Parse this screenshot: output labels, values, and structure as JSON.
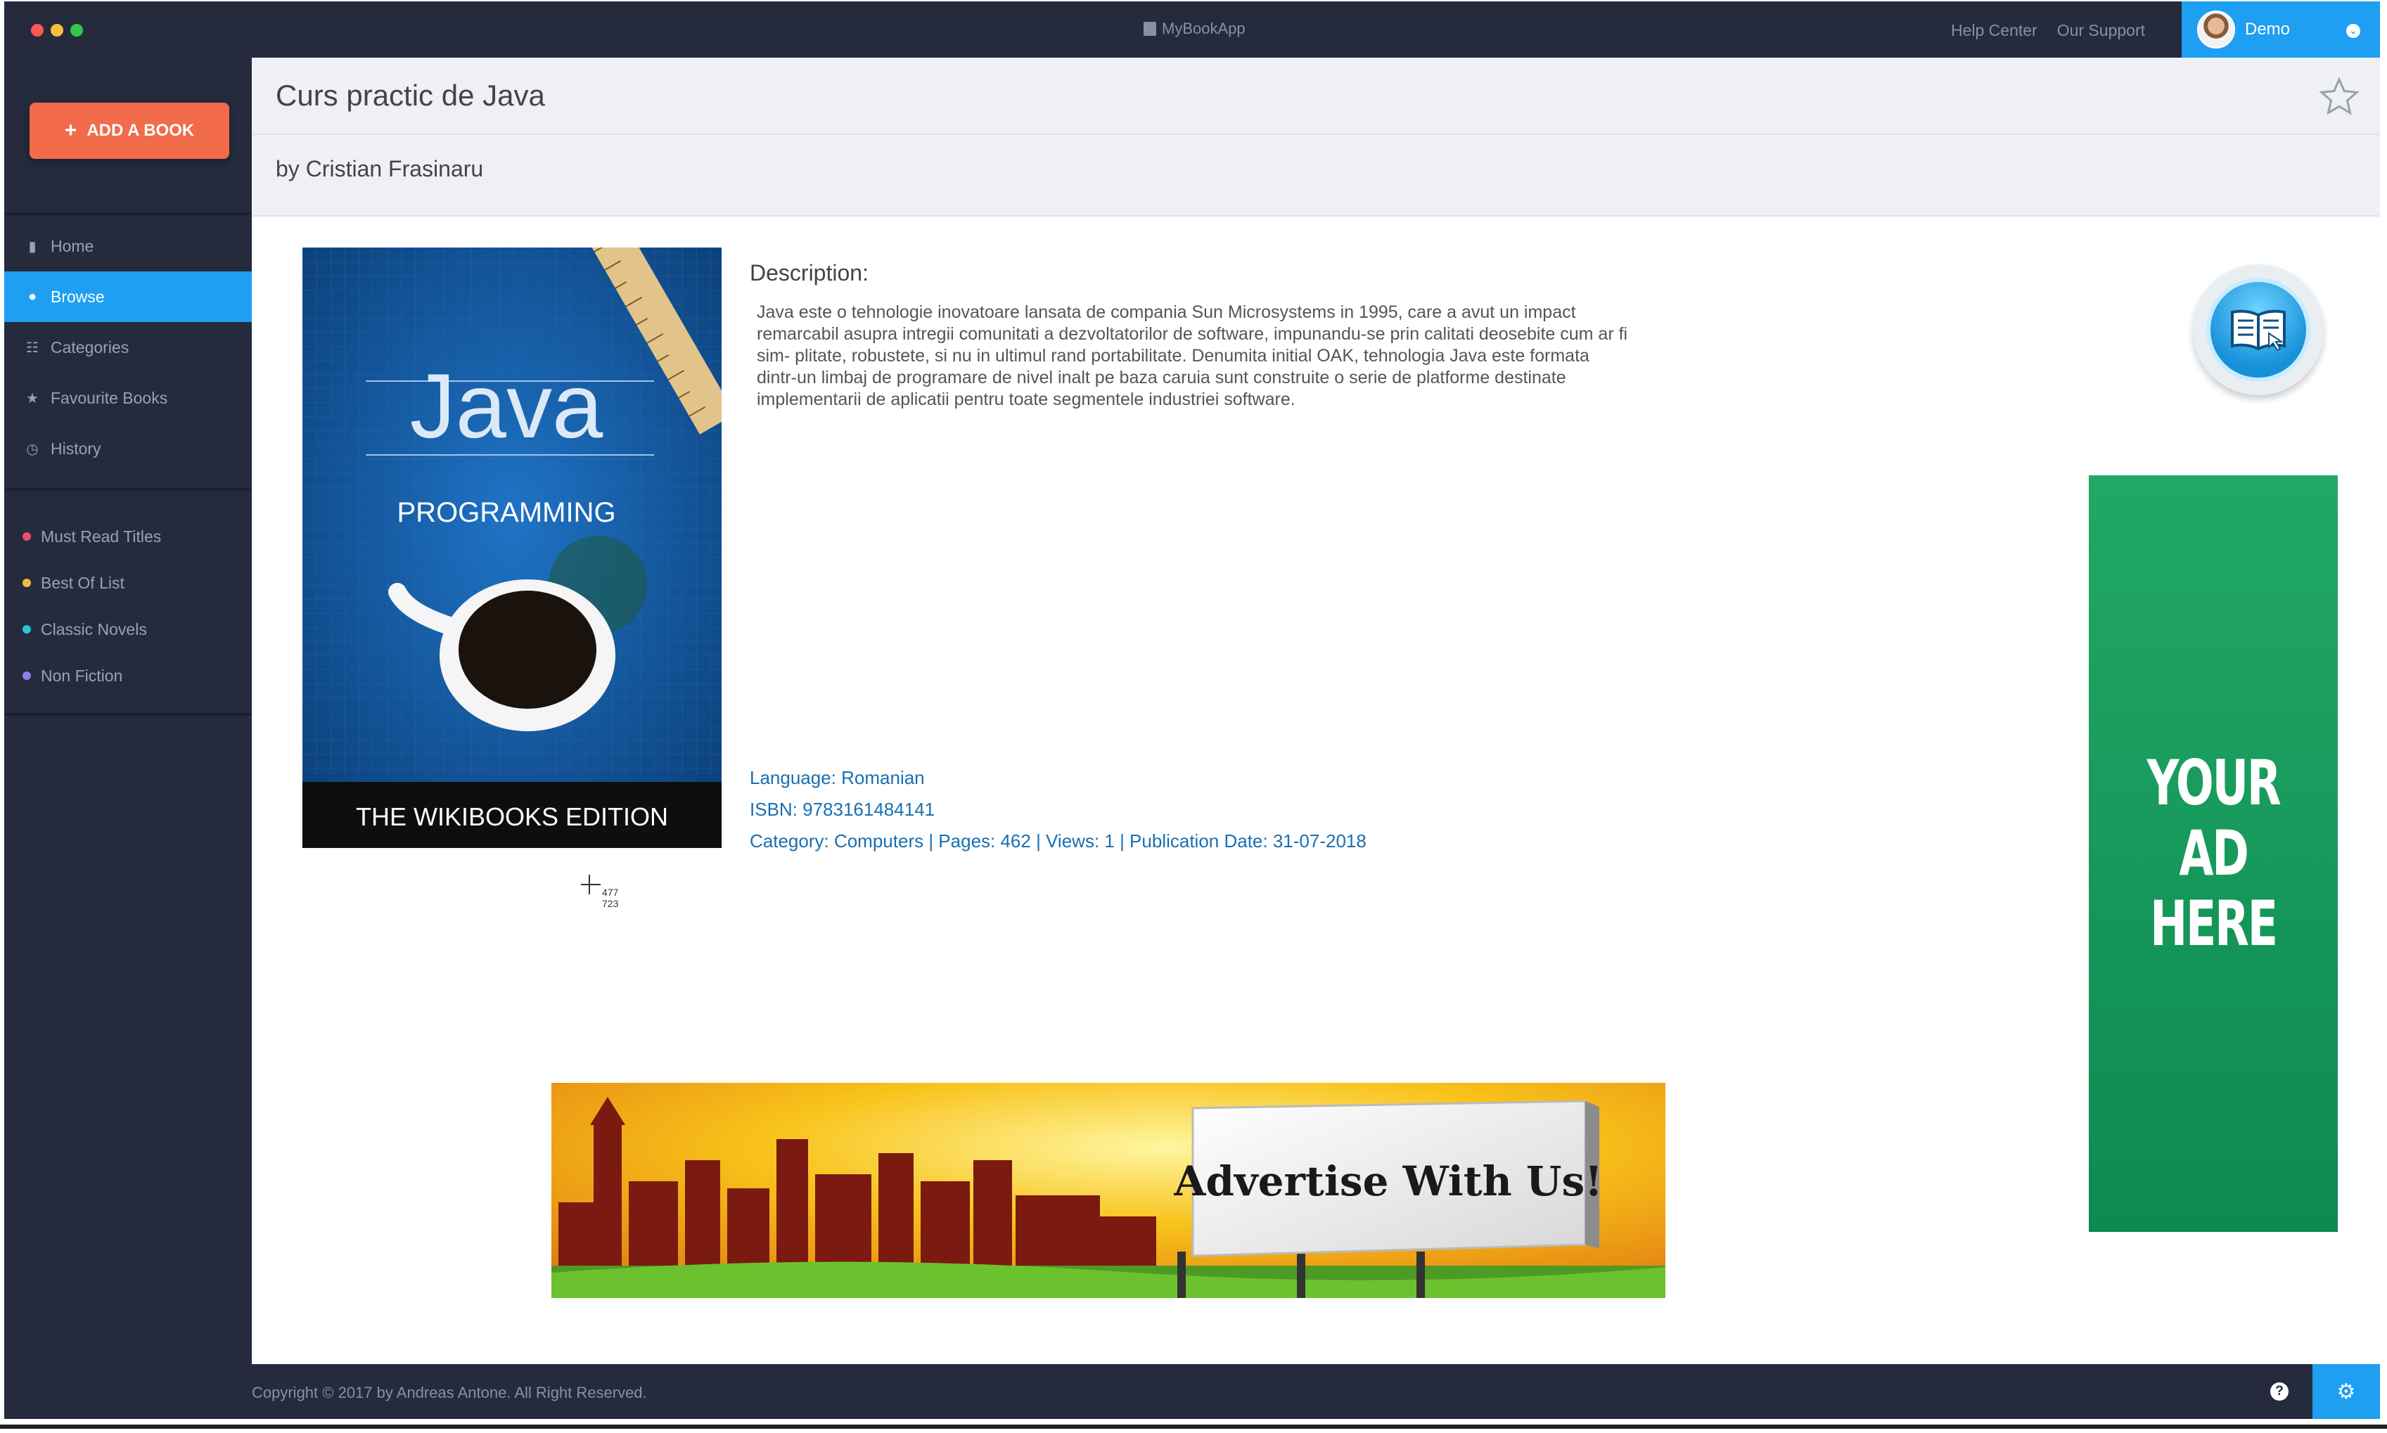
{
  "titlebar": {
    "app_name": "MyBookApp",
    "help_center": "Help Center",
    "our_support": "Our Support",
    "user_name": "Demo"
  },
  "sidebar": {
    "add_book_label": "ADD A BOOK",
    "nav": [
      {
        "label": "Home",
        "icon": "book-icon"
      },
      {
        "label": "Browse",
        "icon": "globe-icon",
        "active": true
      },
      {
        "label": "Categories",
        "icon": "grid-icon"
      },
      {
        "label": "Favourite Books",
        "icon": "star-icon"
      },
      {
        "label": "History",
        "icon": "clock-icon"
      }
    ],
    "lists": [
      {
        "label": "Must Read Titles",
        "color": "#f0506e"
      },
      {
        "label": "Best Of List",
        "color": "#f6b93b"
      },
      {
        "label": "Classic Novels",
        "color": "#2ec4d6"
      },
      {
        "label": "Non Fiction",
        "color": "#8e7cf0"
      }
    ]
  },
  "book": {
    "title": "Curs practic de Java",
    "author": "by Cristian Frasinaru",
    "cover": {
      "title": "Java",
      "subtitle": "PROGRAMMING",
      "edition": "THE WIKIBOOKS EDITION"
    },
    "cursor_readout": [
      "477",
      "723"
    ],
    "description_label": "Description:",
    "description_lines": [
      "Java este o tehnologie inovatoare lansata de compania Sun Microsystems in 1995, care a avut un impact",
      "remarcabil asupra intregii comunitati a dezvoltatorilor de software, impunandu-se prin calitati deosebite cum ar fi",
      "sim- plitate, robustete, si nu in ultimul rand portabilitate. Denumita initial OAK, tehnologia Java este formata",
      "dintr-un limbaj de programare de nivel inalt pe baza caruia sunt construite o serie de platforme destinate",
      "implementarii de aplicatii pentru toate segmentele industriei software."
    ],
    "language": "Language: Romanian",
    "isbn": "ISBN: 9783161484141",
    "details": "Category: Computers | Pages: 462 | Views: 1 | Publication Date: 31-07-2018"
  },
  "ads": {
    "vertical_line1": "YOUR AD",
    "vertical_line2": "HERE",
    "banner_text": "Advertise With Us!"
  },
  "footer": {
    "copyright": "Copyright © 2017 by Andreas Antone. All Right Reserved."
  },
  "colors": {
    "accent": "#1e9ff2",
    "sidebar": "#252b3c",
    "add_button": "#f26b4b",
    "ad_green": "#17a05c",
    "link": "#1a6fb0"
  }
}
